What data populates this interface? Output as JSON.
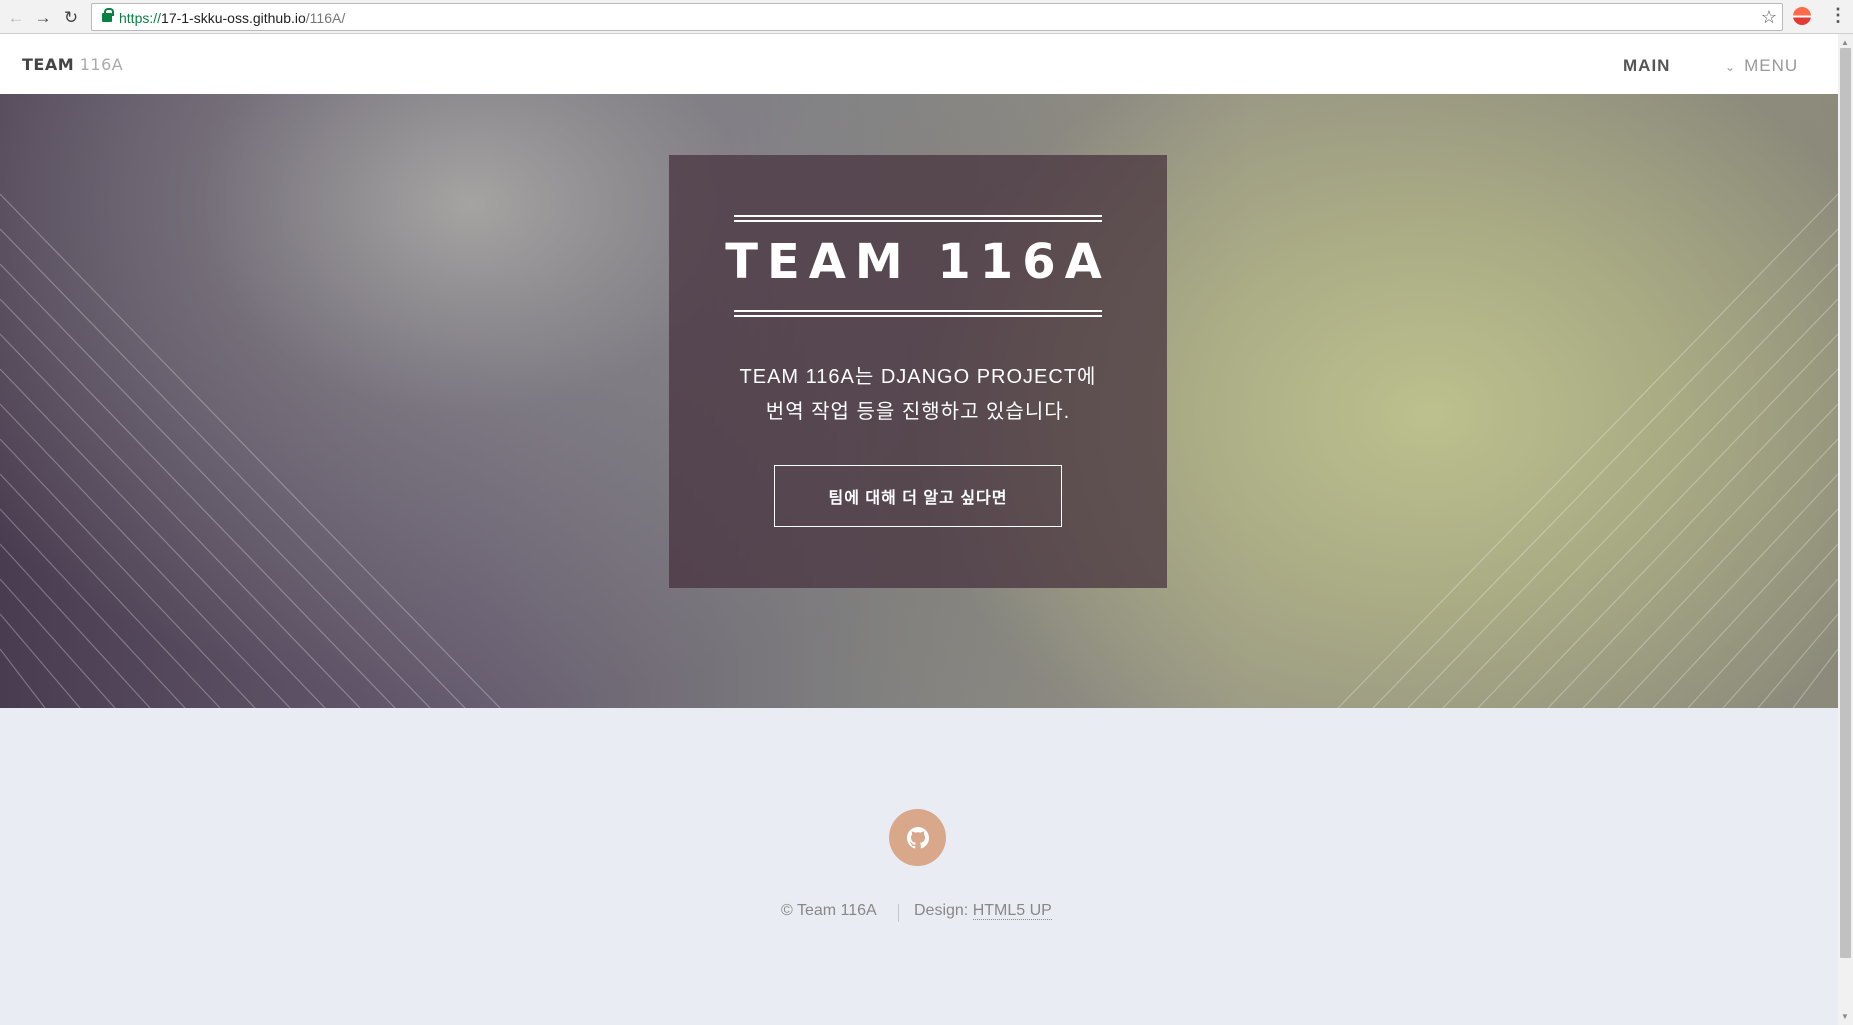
{
  "browser": {
    "url_scheme": "https://",
    "url_host": "17-1-skku-oss.github.io",
    "url_path": "/116A/"
  },
  "header": {
    "brand_strong": "TEAM",
    "brand_light": "116A",
    "main_link": "MAIN",
    "menu_link": "MENU"
  },
  "banner": {
    "title": "TEAM 116A",
    "description_line1": "TEAM 116A는 DJANGO PROJECT에",
    "description_line2": "번역 작업 등을 진행하고 있습니다.",
    "button_label": "팀에 대해 더 알고 싶다면"
  },
  "footer": {
    "copyright": "© Team 116A",
    "design_label": "Design: ",
    "design_link": "HTML5 UP"
  },
  "icons": {
    "back": "back-arrow-icon",
    "forward": "forward-arrow-icon",
    "reload": "reload-icon",
    "lock": "lock-icon",
    "bookmark": "star-icon",
    "extension": "extension-icon",
    "overflow": "kebab-menu-icon",
    "menu_chevron": "chevron-down-icon",
    "github": "github-icon"
  },
  "colors": {
    "github_accent": "#d9a78a",
    "secure_url": "#0b8043",
    "footer_background": "#e9ecf3"
  }
}
